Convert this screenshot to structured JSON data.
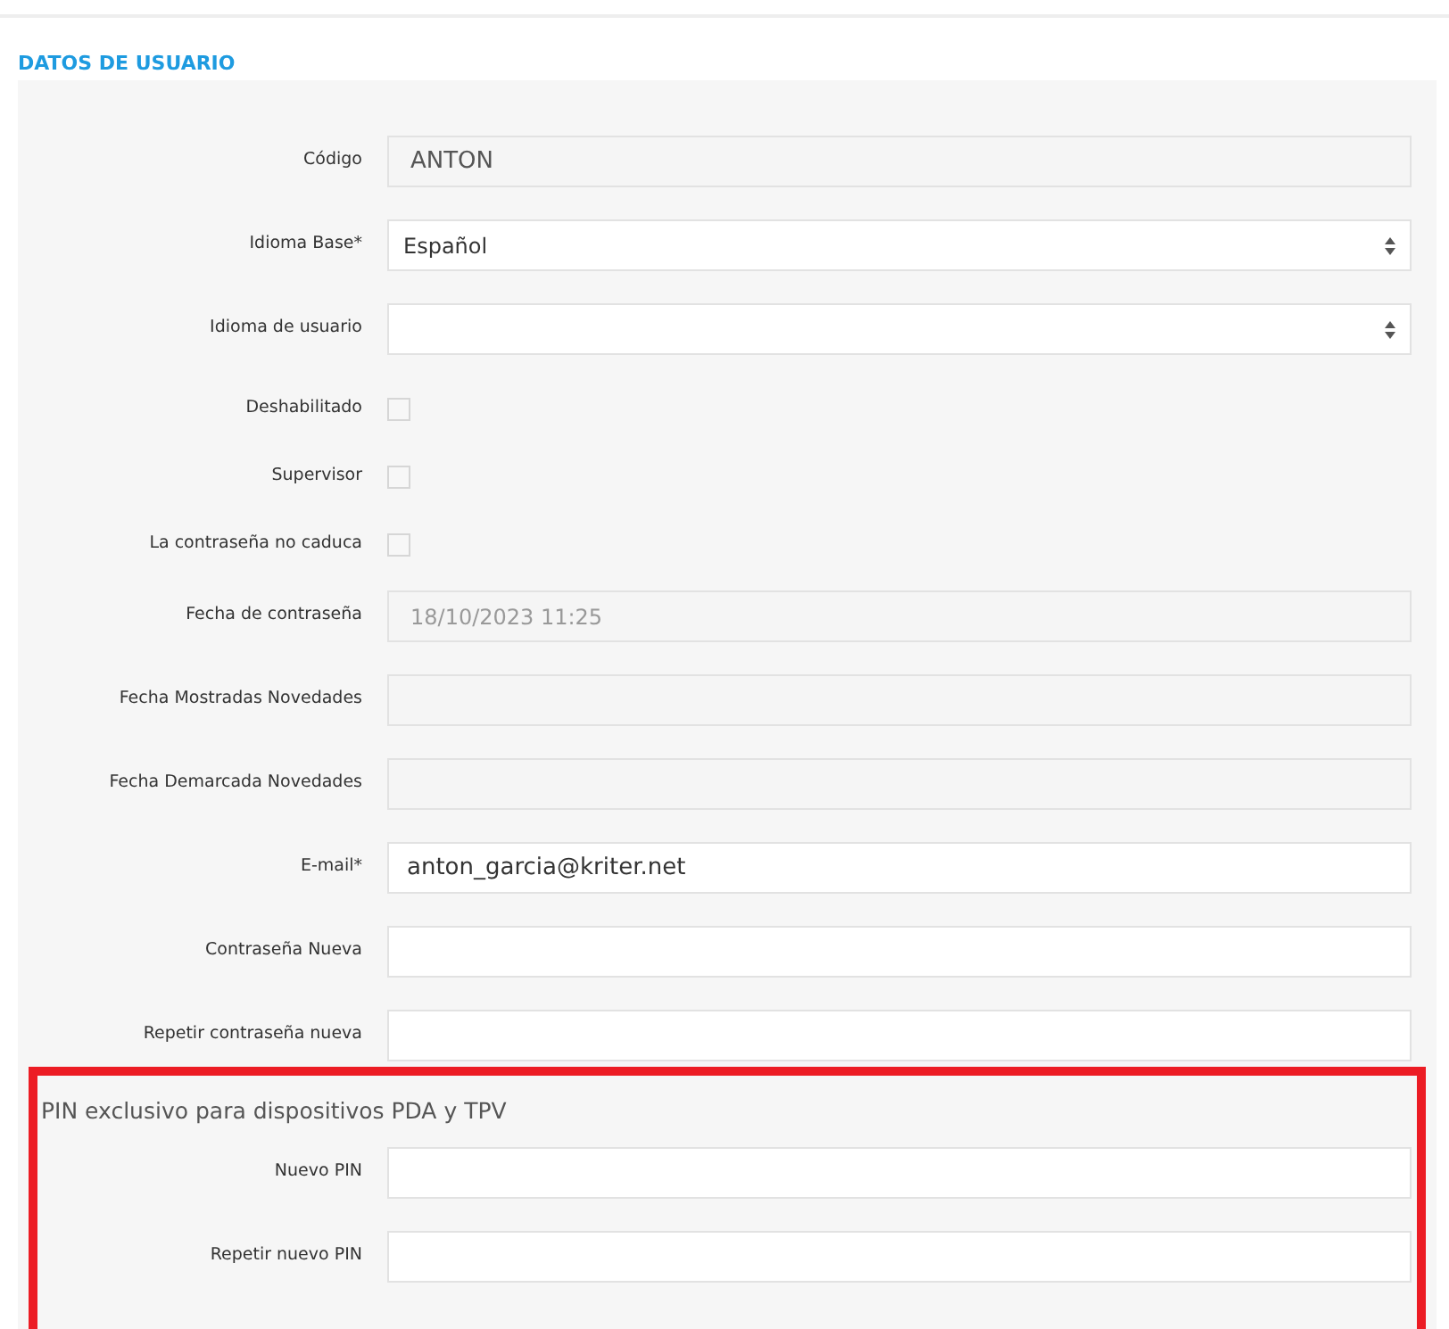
{
  "section_title": "DATOS DE USUARIO",
  "fields": [
    {
      "kind": "readonly",
      "label": "Código",
      "value": "ANTON"
    },
    {
      "kind": "select",
      "label": "Idioma Base*",
      "value": "Español"
    },
    {
      "kind": "select",
      "label": "Idioma de usuario"
    },
    {
      "kind": "checkbox",
      "label": "Deshabilitado",
      "checked": false
    },
    {
      "kind": "checkbox",
      "label": "Supervisor",
      "checked": false
    },
    {
      "kind": "checkbox",
      "label": "La contraseña no caduca",
      "checked": false
    },
    {
      "kind": "readonly",
      "label": "Fecha de contraseña",
      "value": "18/10/2023 11:25"
    },
    {
      "kind": "readonly",
      "label": "Fecha Mostradas Novedades"
    },
    {
      "kind": "readonly",
      "label": "Fecha Demarcada Novedades"
    },
    {
      "kind": "text",
      "label": "E-mail*",
      "value": "anton_garcia@kriter.net"
    },
    {
      "kind": "text",
      "label": "Contraseña Nueva"
    },
    {
      "kind": "text",
      "label": "Repetir contraseña nueva"
    }
  ],
  "pin_section": {
    "title": "PIN exclusivo para dispositivos PDA y TPV",
    "highlighted": true,
    "fields": [
      {
        "kind": "text",
        "label": "Nuevo PIN"
      },
      {
        "kind": "text",
        "label": "Repetir nuevo PIN"
      }
    ]
  }
}
